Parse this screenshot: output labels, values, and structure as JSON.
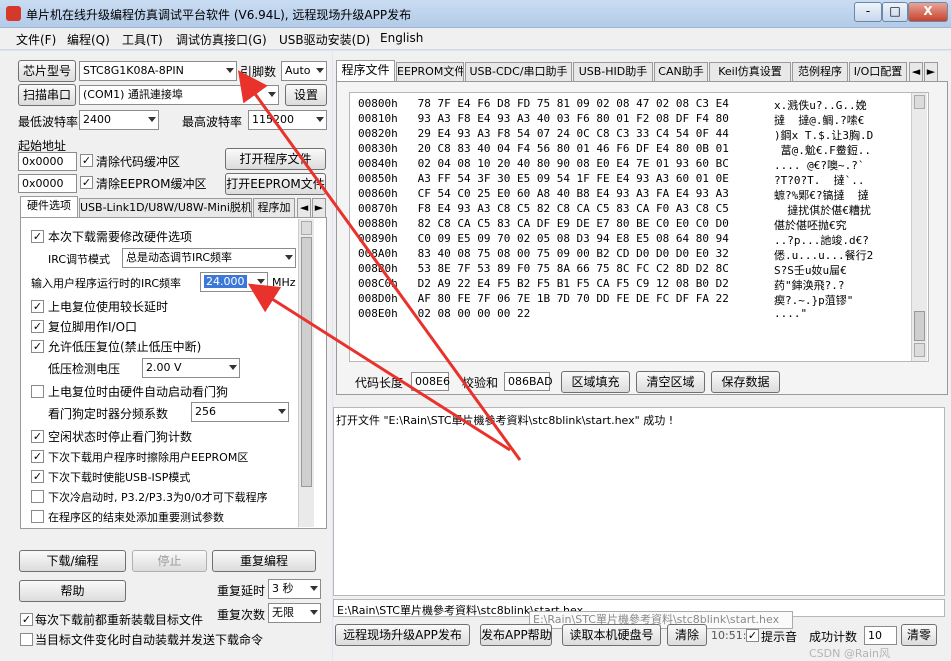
{
  "window": {
    "title": "单片机在线升级编程仿真调试平台软件 (V6.94L), 远程现场升级APP发布",
    "minimize": "-",
    "maximize": "□",
    "close": "X"
  },
  "menu": [
    "文件(F)",
    "编程(Q)",
    "工具(T)",
    "调试仿真接口(G)",
    "USB驱动安装(D)",
    "English"
  ],
  "left": {
    "chip_model_button": "芯片型号",
    "chip_model_value": "STC8G1K08A-8PIN",
    "pin_count_label": "引脚数",
    "pin_count_value": "Auto",
    "scan_port_button": "扫描串口",
    "port_value": "(COM1) 通訊連接埠",
    "settings_button": "设置",
    "min_baud_label": "最低波特率",
    "min_baud_value": "2400",
    "max_baud_label": "最高波特率",
    "max_baud_value": "115200",
    "start_address_label": "起始地址",
    "code_addr_value": "0x0000",
    "clear_code_buffer": "清除代码缓冲区",
    "open_program_file": "打开程序文件",
    "eeprom_addr_value": "0x0000",
    "clear_eeprom_buffer": "清除EEPROM缓冲区",
    "open_eeprom_file": "打开EEPROM文件",
    "tabs": [
      "硬件选项",
      "USB-Link1D/U8W/U8W-Mini脱机",
      "程序加",
      "◄",
      "►"
    ],
    "options": {
      "reload_hw_options": "本次下载需要修改硬件选项",
      "irc_mode_label": "IRC调节模式",
      "irc_mode_value": "总是动态调节IRC频率",
      "irc_freq_label": "输入用户程序运行时的IRC频率",
      "irc_freq_value": "24.000",
      "irc_freq_unit": "MHz",
      "power_on_delay": "上电复位使用较长延时",
      "reset_pin_io": "复位脚用作I/O口",
      "low_voltage_reset": "允许低压复位(禁止低压中断)",
      "low_voltage_threshold_label": "低压检测电压",
      "low_voltage_threshold_value": "2.00 V",
      "watchdog_auto_start": "上电复位时由硬件自动启动看门狗",
      "watchdog_prescale_label": "看门狗定时器分频系数",
      "watchdog_prescale_value": "256",
      "watchdog_idle_stop": "空闲状态时停止看门狗计数",
      "erase_eeprom": "下次下载用户程序时擦除用户EEPROM区",
      "usb_isp": "下次下载时使能USB-ISP模式",
      "cold_start_p32p33": "下次冷启动时, P3.2/P3.3为0/0才可下载程序",
      "add_param_end": "在程序区的结束处添加重要测试参数"
    },
    "download_button": "下载/编程",
    "stop_button": "停止",
    "reprogram_button": "重复编程",
    "help_button": "帮助",
    "repeat_delay_label": "重复延时",
    "repeat_delay_value": "3 秒",
    "repeat_count_label": "重复次数",
    "repeat_count_value": "无限",
    "reload_each_time": "每次下载前都重新装载目标文件",
    "auto_send_on_change": "当目标文件变化时自动装载并发送下载命令"
  },
  "right": {
    "tabs": [
      "程序文件",
      "EEPROM文件",
      "USB-CDC/串口助手",
      "USB-HID助手",
      "CAN助手",
      "Keil仿真设置",
      "范例程序",
      "I/O口配置"
    ],
    "hex_rows": [
      {
        "addr": "00800h",
        "bytes": "78 7F E4 F6 D8 FD 75 81 09 02 08 47 02 08 C3 E4",
        "ascii": "x.溅佚u?..G..娩"
      },
      {
        "addr": "00810h",
        "bytes": "93 A3 F8 E4 93 A3 40 03 F6 80 01 F2 08 DF F4 80",
        "ascii": "撻  撻@.鲷.?嗦€"
      },
      {
        "addr": "00820h",
        "bytes": "29 E4 93 A3 F8 54 07 24 0C C8 C3 33 C4 54 0F 44",
        "ascii": ")鋼x T.$.让3胸.D"
      },
      {
        "addr": "00830h",
        "bytes": "20 C8 83 40 04 F4 56 80 01 46 F6 DF E4 80 0B 01",
        "ascii": " 葍@.魀€.F鲞鋀.."
      },
      {
        "addr": "00840h",
        "bytes": "02 04 08 10 20 40 80 90 08 E0 E4 7E 01 93 60 BC",
        "ascii": ".... @€?噢~.?`"
      },
      {
        "addr": "00850h",
        "bytes": "A3 FF 54 3F 30 E5 09 54 1F FE E4 93 A3 60 01 0E",
        "ascii": "?T?0?T.  撻`.."
      },
      {
        "addr": "00860h",
        "bytes": "CF 54 C0 25 E0 60 A8 40 B8 E4 93 A3 FA E4 93 A3",
        "ascii": "蟅?%郹€?镐撻  撻"
      },
      {
        "addr": "00870h",
        "bytes": "F8 E4 93 A3 C8 C5 82 C8 CA C5 83 CA F0 A3 C8 C5",
        "ascii": "  撻扰倛於偡€糟扰"
      },
      {
        "addr": "00880h",
        "bytes": "82 C8 CA C5 83 CA DF E9 DE E7 80 BE C0 E0 C0 D0",
        "ascii": "偡於偡呸抛€究 "
      },
      {
        "addr": "00890h",
        "bytes": "C0 09 E5 09 70 02 05 08 D3 94 E8 E5 08 64 80 94",
        "ascii": "..?p...訑竣.d€?"
      },
      {
        "addr": "008A0h",
        "bytes": "83 40 08 75 08 00 75 09 00 B2 CD D0 D0 D0 E0 32",
        "ascii": "僁.u...u...餐行2"
      },
      {
        "addr": "008B0h",
        "bytes": "53 8E 7F 53 89 F0 75 8A 66 75 8C FC C2 8D D2 8C",
        "ascii": "S?S壬u奻u屇€"
      },
      {
        "addr": "008C0h",
        "bytes": "D2 A9 22 E4 F5 B2 F5 B1 F5 CA F5 C9 12 08 B0 D2",
        "ascii": "药\"鋛涣飛?.?"
      },
      {
        "addr": "008D0h",
        "bytes": "AF 80 FE 7F 06 7E 1B 7D 70 DD FE DE FC DF FA 22",
        "ascii": "瘈?.~.}p菹镠\""
      },
      {
        "addr": "008E0h",
        "bytes": "02 08 00 00 00 22",
        "ascii": "....\""
      }
    ],
    "code_length_label": "代码长度",
    "code_length_value": "008E6",
    "checksum_label": "校验和",
    "checksum_value": "086BAD",
    "fill_region_button": "区域填充",
    "clear_region_button": "清空区域",
    "save_data_button": "保存数据",
    "log_text": "打开文件 \"E:\\Rain\\STC單片機參考資料\\stc8blink\\start.hex\" 成功 !",
    "path_text": "E:\\Rain\\STC單片機參考資料\\stc8blink\\start.hex",
    "tooltip_text": "E:\\Rain\\STC單片機參考資料\\stc8blink\\start.hex",
    "remote_upgrade_button": "远程现场升级APP发布",
    "publish_help_button": "发布APP帮助",
    "read_disk_button": "读取本机硬盘号",
    "clear_button": "清除",
    "time_text": "10:51:0",
    "prompt_sound_label": "提示音",
    "success_count_label": "成功计数",
    "success_count_value": "10",
    "clear_zero_button": "清零",
    "watermark": "CSDN @Rain风"
  },
  "colors": {
    "arrow": "#e8322b",
    "selection": "#3c78d8"
  }
}
